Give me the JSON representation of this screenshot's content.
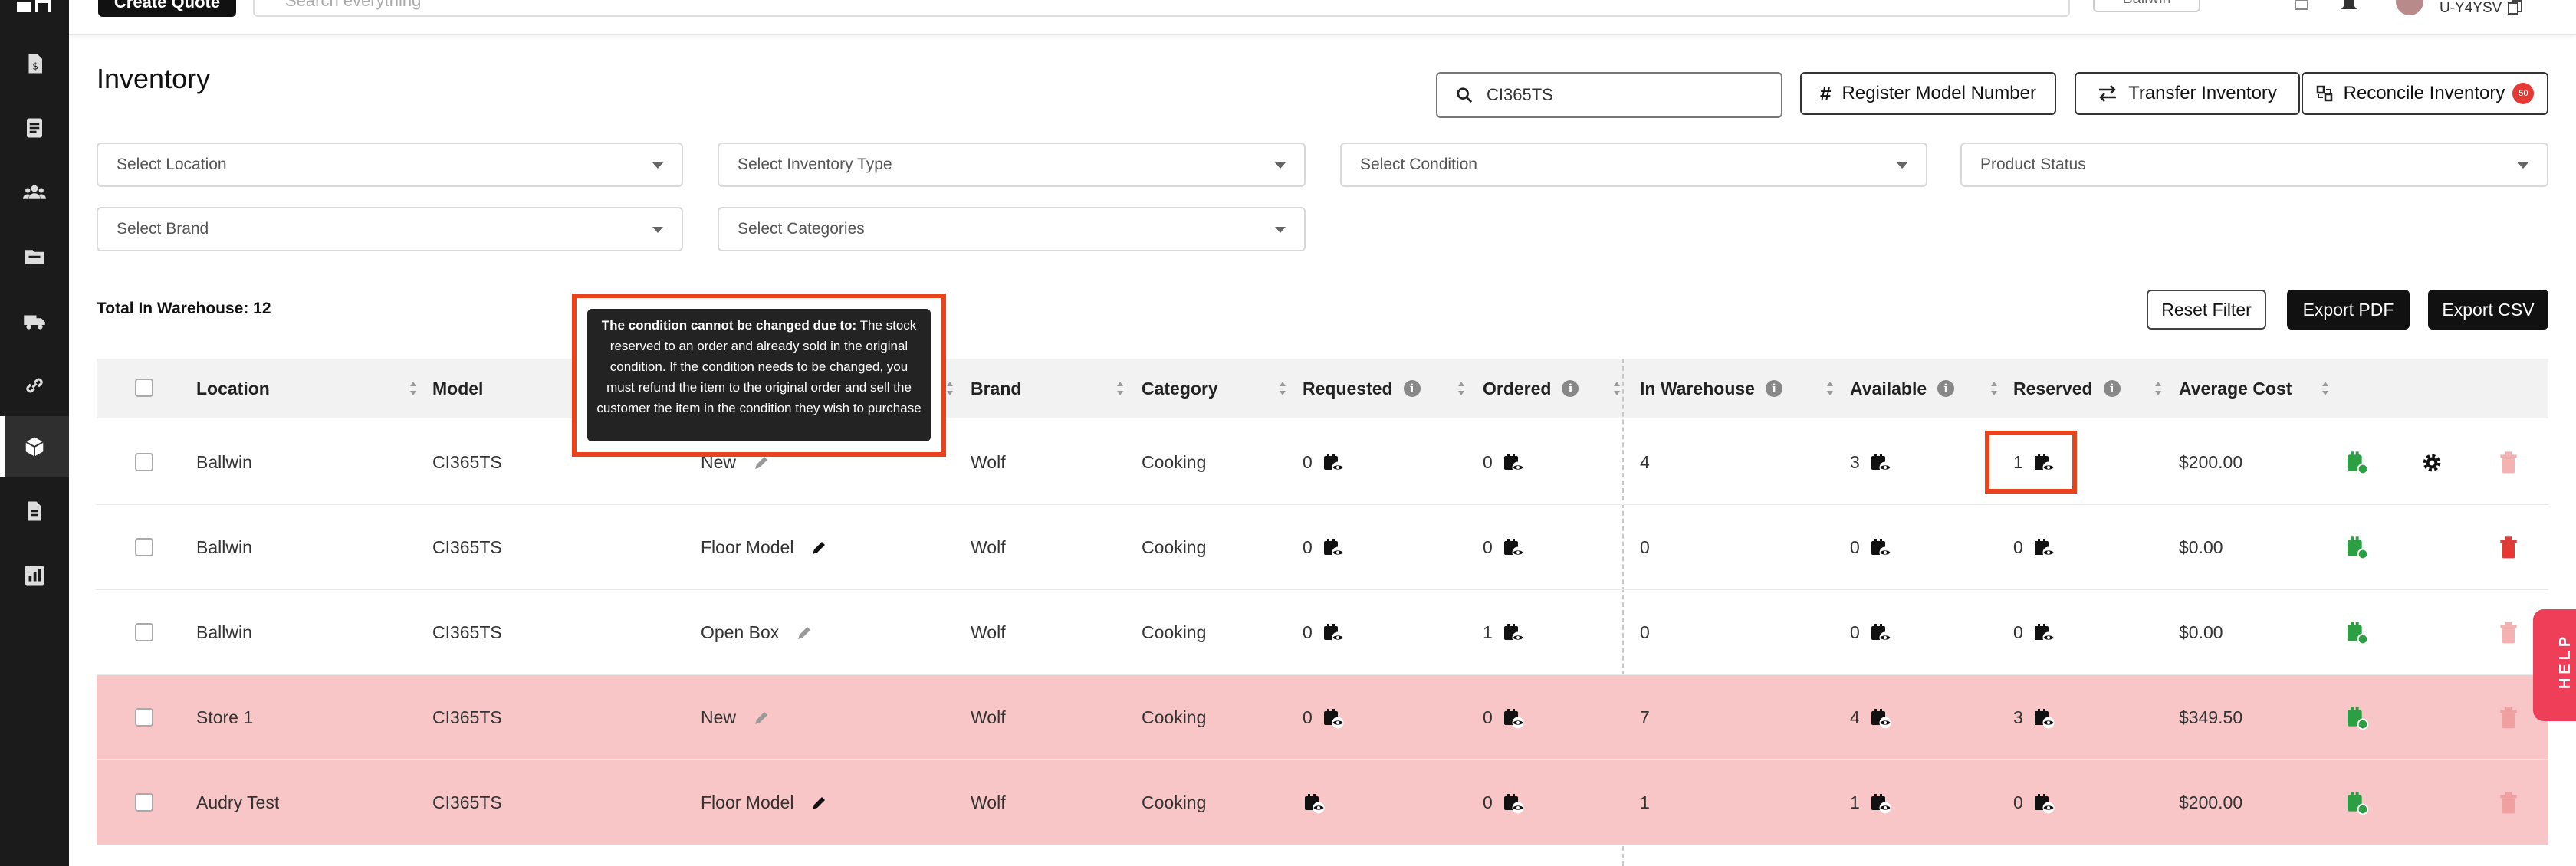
{
  "topbar": {
    "create_quote_label": "Create Quote",
    "search_placeholder": "Search everything",
    "location_label": "Ballwin",
    "user_label": "U-Y4YSV"
  },
  "page": {
    "title": "Inventory"
  },
  "search": {
    "value": "CI365TS"
  },
  "header_buttons": {
    "register": "Register Model Number",
    "transfer": "Transfer Inventory",
    "reconcile": "Reconcile Inventory",
    "reconcile_badge": "50"
  },
  "filters": {
    "location": "Select Location",
    "inventory_type": "Select Inventory Type",
    "condition": "Select Condition",
    "product_status": "Product Status",
    "brand": "Select Brand",
    "categories": "Select Categories"
  },
  "summary": {
    "total": "Total In Warehouse: 12"
  },
  "actions": {
    "reset": "Reset Filter",
    "pdf": "Export PDF",
    "csv": "Export CSV"
  },
  "table": {
    "headers": {
      "location": "Location",
      "model": "Model",
      "brand": "Brand",
      "category": "Category",
      "requested": "Requested",
      "ordered": "Ordered",
      "in_warehouse": "In Warehouse",
      "available": "Available",
      "reserved": "Reserved",
      "average_cost": "Average Cost"
    },
    "rows": [
      {
        "location": "Ballwin",
        "model": "CI365TS",
        "condition": "New",
        "brand": "Wolf",
        "category": "Cooking",
        "requested": "0",
        "ordered": "0",
        "in_warehouse": "4",
        "available": "3",
        "reserved": "1",
        "average_cost": "$200.00"
      },
      {
        "location": "Ballwin",
        "model": "CI365TS",
        "condition": "Floor Model",
        "brand": "Wolf",
        "category": "Cooking",
        "requested": "0",
        "ordered": "0",
        "in_warehouse": "0",
        "available": "0",
        "reserved": "0",
        "average_cost": "$0.00"
      },
      {
        "location": "Ballwin",
        "model": "CI365TS",
        "condition": "Open Box",
        "brand": "Wolf",
        "category": "Cooking",
        "requested": "0",
        "ordered": "1",
        "in_warehouse": "0",
        "available": "0",
        "reserved": "0",
        "average_cost": "$0.00"
      },
      {
        "location": "Store 1",
        "model": "CI365TS",
        "condition": "New",
        "brand": "Wolf",
        "category": "Cooking",
        "requested": "0",
        "ordered": "0",
        "in_warehouse": "7",
        "available": "4",
        "reserved": "3",
        "average_cost": "$349.50"
      },
      {
        "location": "Audry Test",
        "model": "CI365TS",
        "condition": "Floor Model",
        "brand": "Wolf",
        "category": "Cooking",
        "requested": "",
        "ordered": "0",
        "in_warehouse": "1",
        "available": "1",
        "reserved": "0",
        "average_cost": "$200.00"
      }
    ]
  },
  "tooltip": {
    "title": "The condition cannot be changed due to:",
    "body": "The stock reserved to an order and already sold in the original condition. If the condition needs to be changed, you must refund the item to the original order and sell the customer the item in the condition they wish to purchase"
  },
  "help": {
    "label": "HELP"
  },
  "colors": {
    "accent_red": "#e8431c",
    "row_highlight": "#f8c6c6",
    "success_green": "#2e9e44",
    "danger_red": "#e53935"
  }
}
